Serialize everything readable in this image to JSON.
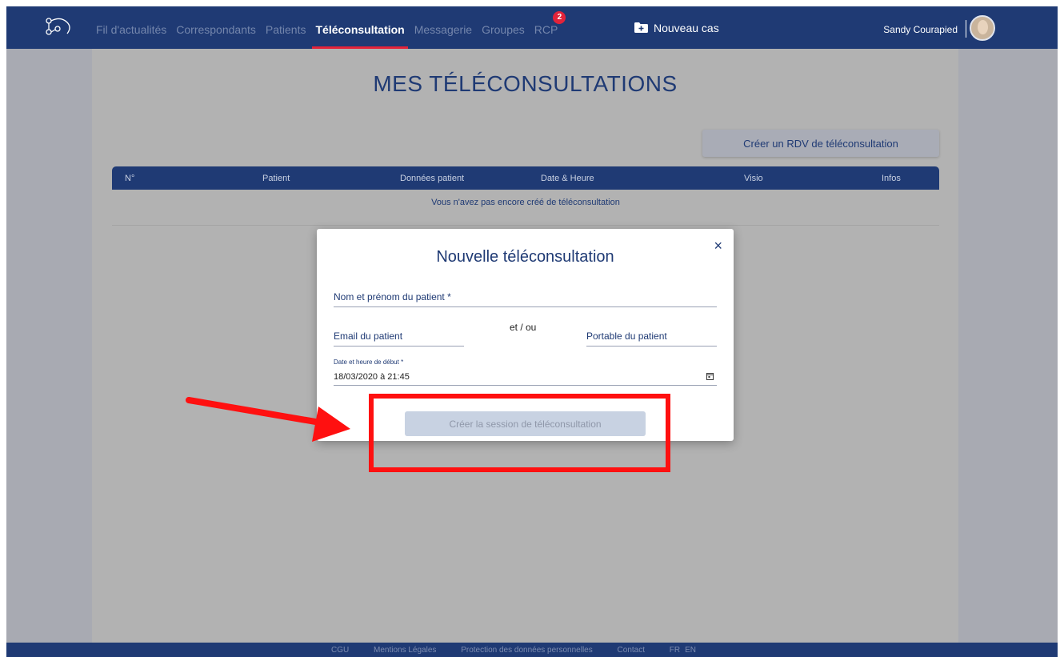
{
  "nav": {
    "items": [
      {
        "label": "Fil d'actualités",
        "active": false
      },
      {
        "label": "Correspondants",
        "active": false
      },
      {
        "label": "Patients",
        "active": false
      },
      {
        "label": "Téléconsultation",
        "active": true
      },
      {
        "label": "Messagerie",
        "active": false
      },
      {
        "label": "Groupes",
        "active": false
      },
      {
        "label": "RCP",
        "active": false,
        "badge": "2"
      }
    ],
    "new_case": "Nouveau cas",
    "icons": {
      "logo": "network-logo-icon",
      "new_case": "folder-plus-icon"
    }
  },
  "user": {
    "name": "Sandy Courapied"
  },
  "page": {
    "title": "MES TÉLÉCONSULTATIONS",
    "create_rdv_button": "Créer un RDV de téléconsultation",
    "table": {
      "headers": [
        "N°",
        "Patient",
        "Données patient",
        "Date & Heure",
        "Visio",
        "Infos"
      ],
      "empty_message": "Vous n'avez pas encore créé de téléconsultation"
    }
  },
  "modal": {
    "title": "Nouvelle téléconsultation",
    "close_symbol": "×",
    "patient_name_label": "Nom et prénom du patient *",
    "email_label": "Email du patient",
    "and_or": "et / ou",
    "phone_label": "Portable du patient",
    "start_label": "Date et heure de début *",
    "start_value": "18/03/2020 à 21:45",
    "submit_button": "Créer la session de téléconsultation",
    "submit_enabled": false
  },
  "footer": {
    "links": [
      "CGU",
      "Mentions Légales",
      "Protection des données personnelles",
      "Contact"
    ],
    "languages": [
      "FR",
      "EN"
    ]
  },
  "colors": {
    "header": "#1f3a74",
    "accent": "#e2233a",
    "overlay": "#a8aab2",
    "annotation": "#ff1010"
  }
}
